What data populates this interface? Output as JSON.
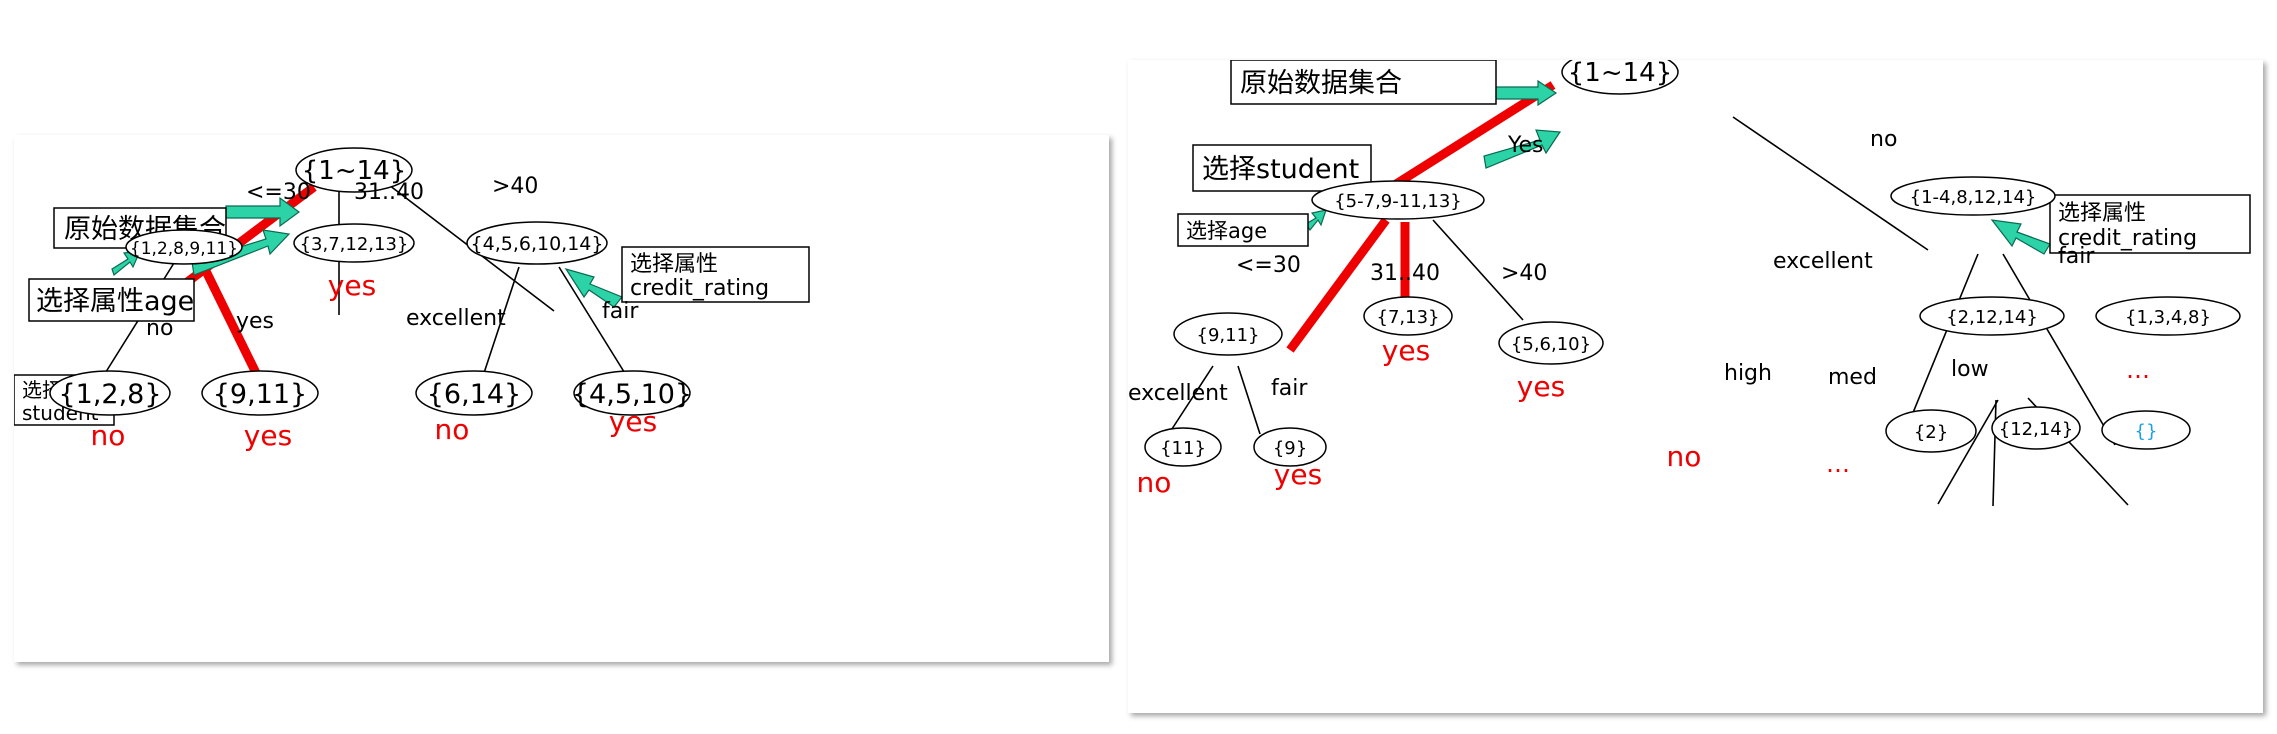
{
  "left": {
    "nodes": {
      "root": "{1~14}",
      "n_young": "{1,2,8,9,11}",
      "n_mid": "{3,7,12,13}",
      "n_old": "{4,5,6,10,14}",
      "leaf_128": "{1,2,8}",
      "leaf_911": "{9,11}",
      "leaf_614": "{6,14}",
      "leaf_4510": "{4,5,10}"
    },
    "edges": {
      "le30": "<=30",
      "mid": "31..40",
      "gt40": ">40",
      "no": "no",
      "yes": "yes",
      "excellent": "excellent",
      "fair": "fair"
    },
    "labels": {
      "original": "原始数据集合",
      "choose_age": "选择属性age",
      "choose_student_1": "选择属性",
      "choose_student_2": "student",
      "choose_credit_1": "选择属性",
      "choose_credit_2": "credit_rating"
    },
    "results": {
      "mid": "yes",
      "leaf_128": "no",
      "leaf_911": "yes",
      "leaf_614": "no",
      "leaf_4510": "yes"
    }
  },
  "right": {
    "nodes": {
      "root": "{1~14}",
      "n_yes": "{5-7,9-11,13}",
      "n_no": "{1-4,8,12,14}",
      "n_911": "{9,11}",
      "n_713": "{7,13}",
      "n_5610": "{5,6,10}",
      "n_21214": "{2,12,14}",
      "n_1348": "{1,3,4,8}",
      "leaf_11": "{11}",
      "leaf_9": "{9}",
      "leaf_2": "{2}",
      "leaf_1214": "{12,14}",
      "leaf_empty": "{}"
    },
    "edges": {
      "yes": "Yes",
      "no": "no",
      "le30": "<=30",
      "mid": "31..40",
      "gt40": ">40",
      "excellent_1": "excellent",
      "fair_1": "fair",
      "excellent_2": "excellent",
      "fair_2": "fair",
      "high": "high",
      "med": "med",
      "low": "low"
    },
    "labels": {
      "original": "原始数据集合",
      "choose_student": "选择student",
      "choose_age": "选择age",
      "choose_credit_1": "选择属性",
      "choose_credit_2": "credit_rating"
    },
    "results": {
      "n_713": "yes",
      "n_5610": "yes",
      "leaf_11": "no",
      "leaf_9": "yes",
      "leaf_2": "no"
    },
    "ellipsis": {
      "n_1348": "…",
      "leaf_1214": "…"
    }
  },
  "colors": {
    "highlight_path": "#ee0000",
    "result_text": "#ee0000",
    "arrow_fill": "#2bd3a6",
    "empty_set": "#1aa0e6"
  }
}
